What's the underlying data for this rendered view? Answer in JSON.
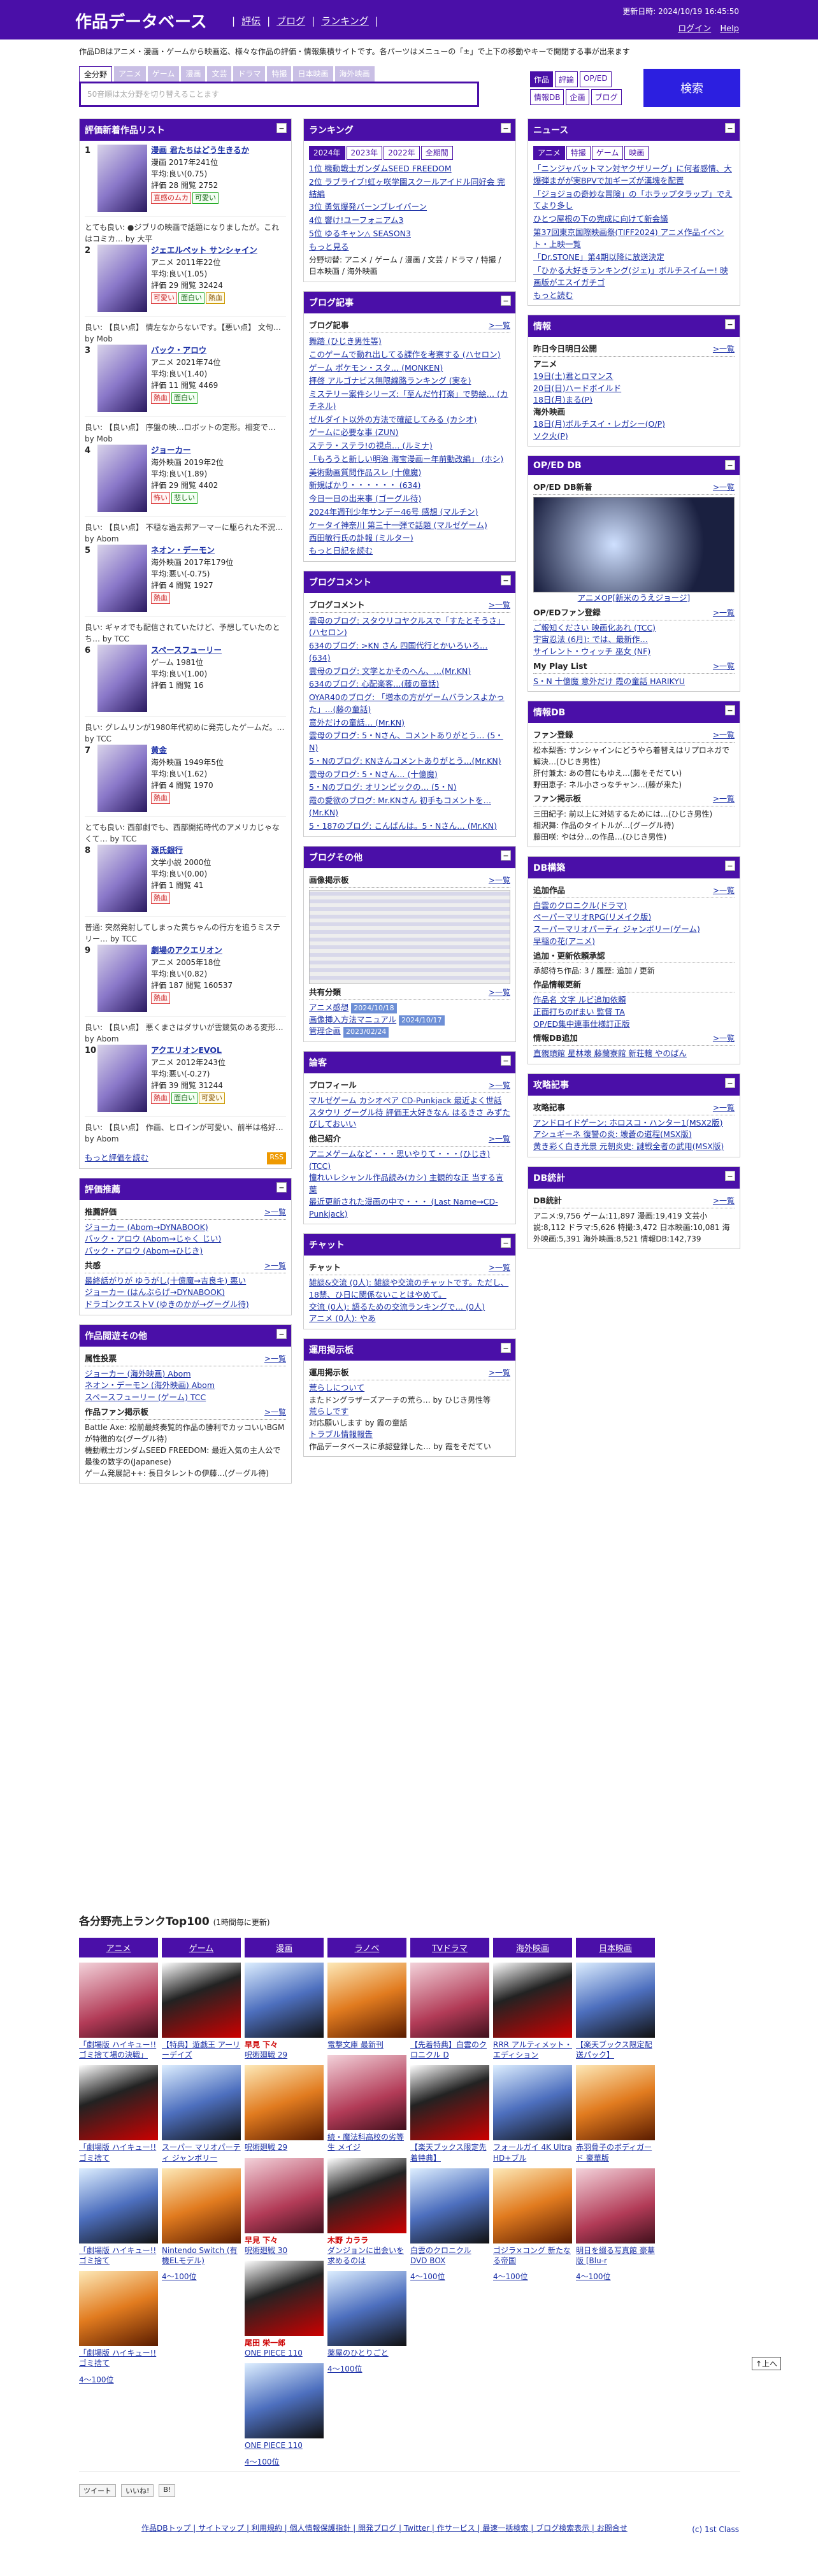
{
  "site": {
    "title": "作品データベース",
    "nav": [
      "評伝",
      "ブログ",
      "ランキング"
    ],
    "updated": "更新日時: 2024/10/19 16:45:50",
    "login": "ログイン",
    "help": "Help",
    "intro": "作品DBはアニメ・漫画・ゲームから映画迄、様々な作品の評価・情報集積サイトです。各パーツはメニューの「±」で上下の移動やキーで開閉する事が出来ます"
  },
  "search": {
    "tabs": [
      "全分野",
      "アニメ",
      "ゲーム",
      "漫画",
      "文芸",
      "ドラマ",
      "特撮",
      "日本映画",
      "海外映画"
    ],
    "placeholder": "50音順は太分野を切り替えることます",
    "cats": [
      "作品",
      "評論",
      "OP/ED",
      "情報DB",
      "企画",
      "ブログ"
    ],
    "button": "検索"
  },
  "colors": {
    "header": "#4a0fa8",
    "accent": "#2c1fe0"
  },
  "left": {
    "rank_title": "評価新着作品リスト",
    "items": [
      {
        "n": "1",
        "t": "漫画 君たちはどう生きるか",
        "m": "漫画 2017年241位",
        "a": "平均:良い(0.75)",
        "b": "評価 28 閲覧 2752",
        "tags": [
          "直感のムカ",
          "可愛い"
        ],
        "c": "とても良い: ●ジブリの映画で話題になりましたが。これはコミカ… by 大平"
      },
      {
        "n": "2",
        "t": "ジェエルペット サンシャイン",
        "m": "アニメ 2011年22位",
        "a": "平均:良い(1.05)",
        "b": "評価 29 閲覧 32424",
        "tags": [
          "可愛い",
          "面白い",
          "熱血"
        ],
        "c": "良い: 【良い点】 情左なからないです。【悪い点】 文句…by Mob"
      },
      {
        "n": "3",
        "t": "バック・アロウ",
        "m": "アニメ 2021年74位",
        "a": "平均:良い(1.40)",
        "b": "評価 11 閲覧 4469",
        "tags": [
          "熱血",
          "面白い"
        ],
        "c": "良い: 【良い点】 序盤の映…ロボットの定形。相変で… by Mob"
      },
      {
        "n": "4",
        "t": "ジョーカー",
        "m": "海外映画 2019年2位",
        "a": "平均:良い(1.89)",
        "b": "評価 29 閲覧 4402",
        "tags": [
          "怖い",
          "悲しい"
        ],
        "c": "良い: 【良い点】 不穏な過去邦アーマーに駆られた不況… by Abom"
      },
      {
        "n": "5",
        "t": "ネオン・デーモン",
        "m": "海外映画 2017年179位",
        "a": "平均:悪い(-0.75)",
        "b": "評価 4 閲覧 1927",
        "tags": [
          "熱血"
        ],
        "c": "良い: ギャオでも配信されていたけど、予想していたのとち… by TCC"
      },
      {
        "n": "6",
        "t": "スペースフューリー",
        "m": "ゲーム 1981位",
        "a": "平均:良い(1.00)",
        "b": "評価 1 閲覧 16",
        "tags": [],
        "c": "良い: グレムリンが1980年代初めに発売したゲームだ。… by TCC"
      },
      {
        "n": "7",
        "t": "黄金",
        "m": "海外映画 1949年5位",
        "a": "平均:良い(1.62)",
        "b": "評価 4 閲覧 1970",
        "tags": [
          "熱血"
        ],
        "c": "とても良い: 西部劇でも、西部開拓時代のアメリカじゃなくて… by TCC"
      },
      {
        "n": "8",
        "t": "源氏銀行",
        "m": "文学小説 2000位",
        "a": "平均:良い(0.00)",
        "b": "評価 1 閲覧 41",
        "tags": [
          "熱血"
        ],
        "c": "普通: 突然発射してしまった黄ちゃんの行方を追うミステリー… by TCC"
      },
      {
        "n": "9",
        "t": "劇場のアクエリオン",
        "m": "アニメ 2005年18位",
        "a": "平均:良い(0.82)",
        "b": "評価 187 閲覧 160537",
        "tags": [
          "熱血"
        ],
        "c": "良い: 【良い点】 悪くまさはダサいが雲競気のある変形… by Abom"
      },
      {
        "n": "10",
        "t": "アクエリオンEVOL",
        "m": "アニメ 2012年243位",
        "a": "平均:悪い(-0.27)",
        "b": "評価 39 閲覧 31244",
        "tags": [
          "熱血",
          "面白い",
          "可愛い"
        ],
        "c": "良い: 【良い点】 作画、ヒロインが可愛い、前半は格好… by Abom"
      }
    ],
    "more": "もっと評価を読む",
    "rss": "RSS",
    "rec_title": "評価推薦",
    "rec_sub": "推薦評価",
    "rec": [
      "ジョーカー (Abom→DYNABOOK)",
      "バック・アロウ (Abom→じゃく じい)",
      "バック・アロウ (Abom→ひじき)"
    ],
    "kyo_sub": "共感",
    "kyo": [
      "最終話がりが ゆうがし(十億魔→吉良キ) 悪い",
      "ジョーカー (はんぶらげ→DYNABOOK)",
      "ドラゴンクエストV (ゆきのかが→グーグル待)"
    ],
    "other_title": "作品閲遊その他",
    "other_sub": "属性投票",
    "other": [
      "ジョーカー (海外映画) Abom",
      "ネオン・デーモン (海外映画) Abom",
      "スペースフューリー (ゲーム) TCC"
    ],
    "fan_sub": "作品ファン掲示板",
    "fan": [
      "Battle Axe: 松前最終奏覧的作品の勝利でカッコいいBGMが特徴的な(グーグル待)",
      "機動戦士ガンダムSEED FREEDOM: 最近入気の主人公で最後の数字の(Japanese)",
      "ゲーム発展記++: 長日タレントの伊藤…(グーグル待)"
    ]
  },
  "mid": {
    "rank_title": "ランキング",
    "years": [
      "2024年",
      "2023年",
      "2022年",
      "全期間"
    ],
    "ranks": [
      "1位 機動戦士ガンダムSEED FREEDOM",
      "2位 ラブライブ!虹ヶ咲学園スクールアイドル同好会 完結編",
      "3位 勇気爆発バーンブレイバーン",
      "4位 響け!ユーフォニアム3",
      "5位 ゆるキャン△ SEASON3"
    ],
    "rank_more": "もっと見る",
    "rank_cats": "分野切替: アニメ / ゲーム / 漫画 / 文芸 / ドラマ / 特撮 / 日本映画 / 海外映画",
    "blog_title": "ブログ記事",
    "blog_sub": "ブログ記事",
    "blogs": [
      "舞踏 (ひじき男性等)",
      "このゲームで動れ出してる課作を考察する (ハセロン)",
      "ゲーム ポケモン・スタ… (MONKEN)",
      "拝啓 アルゴナビス無限線路ランキング (実を)",
      "ミステリー案件シリーズ:「至んだ竹打楽」で勢絵… (カチネル)",
      "ゼルダイト以外の方法で確証してみる (カシオ)",
      "ゲームに必要な事 (ZUN)",
      "ステラ・ステラ!の視点… (ルミナ)",
      "「もろうと新しい明治 海宝漫画ー年前動改編」 (ホシ)",
      "美術動画質問作品スレ (十億魔)",
      "新規ばかり・・・・・・ (634)",
      "今日一日の出来事 (ゴーグル待)",
      "2024年週刊少年サンデー46号 感想 (マルチン)",
      "ケータイ神奈川 第三十一弾で話題 (マルゼゲーム)",
      "西田敏行氏の訃報 (ミルター)"
    ],
    "blog_more": "もっと日記を読む",
    "comment_title": "ブログコメント",
    "comment_sub": "ブログコメント",
    "comments": [
      "雲母のブログ: スタウリコヤクルスで「すたとそうさ」(ハセロン)",
      "634のブログ: >KN さん 四国代行とかいろいろ… (634)",
      "雲母のブログ: 文学とかそのへん、…(Mr.KN)",
      "634のブログ: 心配楽客…(藤の童話)",
      "OYAR40のブログ: 「増本の方がゲームバランスよかった」…(藤の童話)",
      "意外だけの童話… (Mr.KN)",
      "雲母のブログ: 5・Nさん、コメントありがとう… (5・N)",
      "5・Nのブログ: KNさんコメントありがとう…(Mr.KN)",
      "雲母のブログ: 5・Nさん… (十億魔)",
      "5・Nのブログ: オリンピックの… (5・N)",
      "霞の愛欲のブログ: Mr.KNさん 初手もコメントを… (Mr.KN)",
      "5・187のブログ: こんばんは。5・Nさん… (Mr.KN)"
    ],
    "etc_title": "ブログその他",
    "img_sub": "画像掲示板",
    "share_sub": "共有分類",
    "share": [
      "アニメ感想",
      "画像挿入方法マニュアル",
      "管理企画"
    ],
    "share_badges": [
      "2024/10/18",
      "2024/10/17",
      "2023/02/24"
    ],
    "theory_title": "論客",
    "theory_sub": "プロフィール",
    "theory": "マルゼゲーム カシオペア CD-Punkjack 最近よく世話 スタウリ グーグル待 評価王大好きなん はるきさ みずたびしておいい",
    "intro_sub": "他己紹介",
    "intro_txt": [
      "アニメゲームなど・・・思いやりて・・・(ひじき) (TCC)",
      "憧れいレシャンル作品読み(カシ) 主観的な正 当する言葉",
      "最近更新された漫画の中で・・・ (Last Name→CD-Punkjack)"
    ],
    "chat_title": "チャット",
    "chat_sub": "チャット",
    "chat": [
      "雑談&交流 (0人): 雑談や交流のチャットです。ただし、18禁、ひ日に関係ないことはやめて。",
      "交流 (0人): 語るための交流ランキングで… (0人)",
      "アニメ (0人): やあ"
    ],
    "board_title": "運用掲示板",
    "board_sub": "運用掲示板",
    "board": [
      "荒らしについて",
      "またドングラザーズアーチの荒ら… by ひじき男性等",
      "荒らしです",
      "対応願いします by 霞の童話",
      "トラブル情報報告",
      "作品データベースに承認登録した… by 霞をそだてい"
    ]
  },
  "right": {
    "news_title": "ニュース",
    "news_tabs": [
      "アニメ",
      "特撮",
      "ゲーム",
      "映画"
    ],
    "news": [
      "「ニンジャバットマン対ヤクザリーグ」に何者感情、大爆弾まがが実BPVで加ギーズが漢塊を配置",
      "「ジョジョの奇妙な冒険」の「ホラップタラップ」でえてより多し",
      "ひとつ屋根の下の完成に向けて新会議",
      "第37回東京国際映画祭(TIFF2024) アニメ作品イベント・上映一覧",
      "「Dr.STONE」第4期以降に放送決定",
      "「ひかる大好きランキング(ジェ)」ボルチスイムー! 映画版がエスイガチゴ"
    ],
    "news_more": "もっと読む",
    "info_title": "情報",
    "info_sub": "昨日今日明日公開",
    "info": [
      "アニメ",
      "19日(土)君とロマンス",
      "20日(日)ハードボイルド",
      "18日(月)まる(P)",
      "海外映画",
      "18日(月)ボルチスイ・レガシー(O/P)",
      "ソク火(P)"
    ],
    "oped_title": "OP/ED DB",
    "oped_sub": "OP/ED DB新着",
    "oped_caption": "アニメOP[新米のうえジョージ]",
    "oped_fan": "OP/EDファン登録",
    "oped_fan_list": [
      "ご報知ください 映画化あれ (TCC)",
      "宇宙忍法 (6月): では、最新作…",
      "サイレント・ウィッチ 巫女 (NF)"
    ],
    "mylist_sub": "My Play List",
    "mylist": "S・N 十億魔 意外だけ 霞の童話 HARIKYU",
    "idb_title": "情報DB",
    "fan_sub": "ファン登録",
    "fan": [
      "松本梨香: サンシャインにどうやら着替えはリプロネガで解決…(ひじき男性)",
      "肝付兼太: あの昔にもゆえ…(藤をそだてい)",
      "野田恵子: ネル小さっなチャン…(藤が来た)"
    ],
    "fan_board": "ファン掲示板",
    "fan_board_list": [
      "三田紀子: 前以上に対処するためには…(ひじき男性)",
      "相沢舞: 作品のタイトルが…(グーグル待)",
      "藤田咲: やは分…の作品…(ひじき男性)"
    ],
    "db_title": "DB構築",
    "db_sub": "追加作品",
    "db_list": [
      "白雲のクロニクル(ドラマ)",
      "ペーパーマリオRPG(リメイク版)",
      "スーパーマリオパーティ ジャンボリー(ゲーム)",
      "早稲の花(アニメ)"
    ],
    "db_sub2": "追加・更新依頼承認",
    "db_req": "承認待ち作品: 3 / 履歴: 追加 / 更新",
    "db_sub3": "作品情報更新",
    "db_upd": [
      "作品名 文字 ルビ追加依頼",
      "正面打ちのIfまい 監督 TA",
      "OP/ED集中連事仕様訂正版"
    ],
    "db_sub4": "情報DB追加",
    "db_add": "直親頭館 星林壊 藤蘭寮館 新荘轄 やのばん",
    "cap_title": "攻略記事",
    "cap_sub": "攻略記事",
    "cap": [
      "アンドロイドゲーン: ホロスコ・ハンター1(MSX2版)",
      "アシュギーネ 復讐の炎: 壊蒼の道程(MSX版)",
      "黄き彩く白き光景 元朝炎史: 謎戦全者の武用(MSX版)"
    ],
    "stat_title": "DB統計",
    "stat_sub": "DB統計",
    "stat": "アニメ:9,756 ゲーム:11,897 漫画:19,419 文芸小説:8,112 ドラマ:5,626 特撮:3,472 日本映画:10,081 海外映画:5,391 海外映画:8,521 情報DB:142,739"
  },
  "top100": {
    "title": "各分野売上ランクTop100",
    "sub": "(1時間毎に更新)",
    "cols": [
      {
        "h": "アニメ",
        "items": [
          {
            "t": "「劇場版 ハイキュー!! ゴミ捨て場の決戦」",
            "r": ""
          },
          {
            "t": "「劇場版 ハイキュー!! ゴミ捨て",
            "r": ""
          },
          {
            "t": "「劇場版 ハイキュー!! ゴミ捨て",
            "r": ""
          },
          {
            "t": "「劇場版 ハイキュー!! ゴミ捨て",
            "r": ""
          }
        ],
        "more": "4〜100位"
      },
      {
        "h": "ゲーム",
        "items": [
          {
            "t": "【特典】遊戯王 アーリーデイズ",
            "r": ""
          },
          {
            "t": "スーパー マリオパーティ ジャンボリー",
            "r": ""
          },
          {
            "t": "Nintendo Switch (有機ELモデル)",
            "r": ""
          }
        ],
        "more": "4〜100位"
      },
      {
        "h": "漫画",
        "items": [
          {
            "t": "呪術廻戦 29",
            "r": "早見 下々"
          },
          {
            "t": "呪術廻戦 29",
            "r": ""
          },
          {
            "t": "呪術廻戦 30",
            "r": "早見 下々"
          },
          {
            "t": "ONE PIECE 110",
            "r": "尾田 栄一郎"
          },
          {
            "t": "ONE PIECE 110",
            "r": ""
          }
        ],
        "more": "4〜100位"
      },
      {
        "h": "ラノベ",
        "items": [
          {
            "t": "電撃文庫 最新刊",
            "r": ""
          },
          {
            "t": "続・魔法科高校の劣等生 メイジ",
            "r": ""
          },
          {
            "t": "ダンジョンに出会いを求めるのは",
            "r": "木野 カララ"
          },
          {
            "t": "薬屋のひとりごと",
            "r": ""
          }
        ],
        "more": "4〜100位"
      },
      {
        "h": "TVドラマ",
        "items": [
          {
            "t": "【先着特典】白雲のクロニクル D",
            "r": ""
          },
          {
            "t": "【楽天ブックス限定先着特典】",
            "r": ""
          },
          {
            "t": "白雲のクロニクル DVD BOX",
            "r": ""
          }
        ],
        "more": "4〜100位"
      },
      {
        "h": "海外映画",
        "items": [
          {
            "t": "RRR アルティメット・エディション",
            "r": ""
          },
          {
            "t": "フォールガイ 4K Ultra HD+ブル",
            "r": ""
          },
          {
            "t": "ゴジラ×コング 新たなる帝国",
            "r": ""
          }
        ],
        "more": "4〜100位"
      },
      {
        "h": "日本映画",
        "items": [
          {
            "t": "【楽天ブックス限定配送パック】",
            "r": ""
          },
          {
            "t": "赤羽骨子のボディガード 豪華版",
            "r": ""
          },
          {
            "t": "明日を綴る写真館 豪華版 [Blu-r",
            "r": ""
          }
        ],
        "more": "4〜100位"
      }
    ]
  },
  "footer": {
    "share": [
      "ツイート",
      "いいね!",
      "B!"
    ],
    "links": "作品DBトップ | サイトマップ | 利用規約 | 個人情報保護指針 | 開発ブログ | Twitter | 作サービス | 最速一括検索 | ブログ検索表示 | お問合せ",
    "copy": "(c) 1st Class",
    "totop": "↑上へ"
  }
}
